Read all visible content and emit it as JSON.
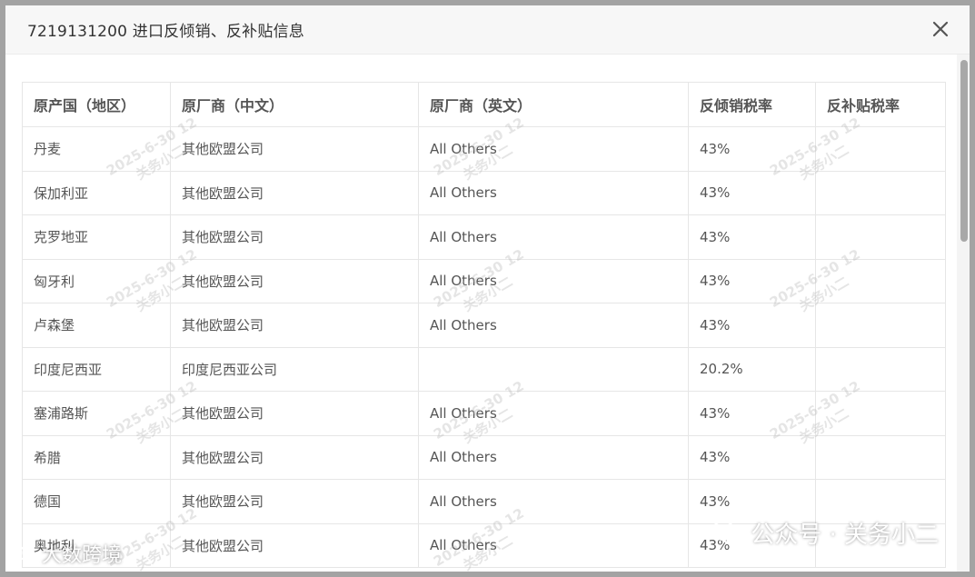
{
  "dialog": {
    "title": "7219131200 进口反倾销、反补贴信息",
    "close_icon": "close-icon"
  },
  "table": {
    "columns": [
      "原产国（地区）",
      "原厂商（中文）",
      "原厂商（英文）",
      "反倾销税率",
      "反补贴税率"
    ],
    "rows": [
      [
        "丹麦",
        "其他欧盟公司",
        "All Others",
        "43%",
        ""
      ],
      [
        "保加利亚",
        "其他欧盟公司",
        "All Others",
        "43%",
        ""
      ],
      [
        "克罗地亚",
        "其他欧盟公司",
        "All Others",
        "43%",
        ""
      ],
      [
        "匈牙利",
        "其他欧盟公司",
        "All Others",
        "43%",
        ""
      ],
      [
        "卢森堡",
        "其他欧盟公司",
        "All Others",
        "43%",
        ""
      ],
      [
        "印度尼西亚",
        "印度尼西亚公司",
        "",
        "20.2%",
        ""
      ],
      [
        "塞浦路斯",
        "其他欧盟公司",
        "All Others",
        "43%",
        ""
      ],
      [
        "希腊",
        "其他欧盟公司",
        "All Others",
        "43%",
        ""
      ],
      [
        "德国",
        "其他欧盟公司",
        "All Others",
        "43%",
        ""
      ],
      [
        "奥地利",
        "其他欧盟公司",
        "All Others",
        "43%",
        ""
      ]
    ]
  },
  "watermark": {
    "date": "2025-6-30 12",
    "author": "关务小二"
  },
  "overlay": {
    "brand_text": "公众号 · 关务小二",
    "corner_text": "大数跨境"
  },
  "colors": {
    "header_bg": "#f7f7f7",
    "border": "#e6e6e6",
    "text": "#555555"
  }
}
